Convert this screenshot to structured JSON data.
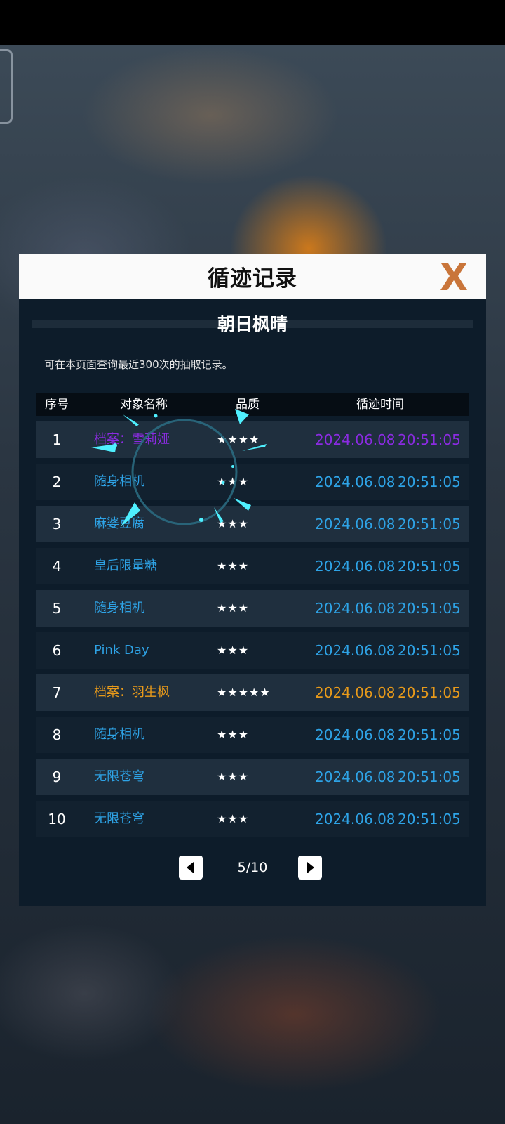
{
  "dialog": {
    "title": "循迹记录",
    "banner": "朝日枫晴",
    "hint": "可在本页面查询最近300次的抽取记录。"
  },
  "table": {
    "headers": {
      "index": "序号",
      "name": "对象名称",
      "quality": "品质",
      "time": "循迹时间"
    },
    "rows": [
      {
        "index": "1",
        "name": "档案：雪莉娅",
        "stars": "★★★★",
        "date": "2024.06.08",
        "time": "20:51:05",
        "color": "#8b2be2"
      },
      {
        "index": "2",
        "name": "随身相机",
        "stars": "★★★",
        "date": "2024.06.08",
        "time": "20:51:05",
        "color": "#2ea3e6"
      },
      {
        "index": "3",
        "name": "麻婆豆腐",
        "stars": "★★★",
        "date": "2024.06.08",
        "time": "20:51:05",
        "color": "#2ea3e6"
      },
      {
        "index": "4",
        "name": "皇后限量糖",
        "stars": "★★★",
        "date": "2024.06.08",
        "time": "20:51:05",
        "color": "#2ea3e6"
      },
      {
        "index": "5",
        "name": "随身相机",
        "stars": "★★★",
        "date": "2024.06.08",
        "time": "20:51:05",
        "color": "#2ea3e6"
      },
      {
        "index": "6",
        "name": "Pink Day",
        "stars": "★★★",
        "date": "2024.06.08",
        "time": "20:51:05",
        "color": "#2ea3e6"
      },
      {
        "index": "7",
        "name": "档案：羽生枫",
        "stars": "★★★★★",
        "date": "2024.06.08",
        "time": "20:51:05",
        "color": "#e89a1a"
      },
      {
        "index": "8",
        "name": "随身相机",
        "stars": "★★★",
        "date": "2024.06.08",
        "time": "20:51:05",
        "color": "#2ea3e6"
      },
      {
        "index": "9",
        "name": "无限苍穹",
        "stars": "★★★",
        "date": "2024.06.08",
        "time": "20:51:05",
        "color": "#2ea3e6"
      },
      {
        "index": "10",
        "name": "无限苍穹",
        "stars": "★★★",
        "date": "2024.06.08",
        "time": "20:51:05",
        "color": "#2ea3e6"
      }
    ]
  },
  "pager": {
    "label": "5/10"
  },
  "colors": {
    "close_icon": "#c9753a",
    "rare4": "#8b2be2",
    "rare3": "#2ea3e6",
    "rare5": "#e89a1a",
    "spinner": "#4ff0ff"
  }
}
